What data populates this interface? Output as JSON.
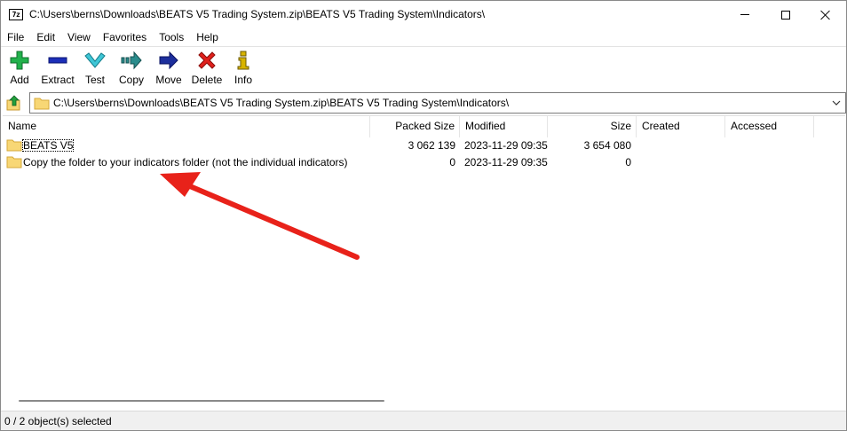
{
  "window": {
    "title": "C:\\Users\\berns\\Downloads\\BEATS V5 Trading System.zip\\BEATS V5 Trading System\\Indicators\\",
    "app_icon_text": "7z"
  },
  "menu": [
    "File",
    "Edit",
    "View",
    "Favorites",
    "Tools",
    "Help"
  ],
  "toolbar": {
    "add": "Add",
    "extract": "Extract",
    "test": "Test",
    "copy": "Copy",
    "move": "Move",
    "delete": "Delete",
    "info": "Info"
  },
  "address": {
    "path": "C:\\Users\\berns\\Downloads\\BEATS V5 Trading System.zip\\BEATS V5 Trading System\\Indicators\\"
  },
  "columns": {
    "name": "Name",
    "packed_size": "Packed Size",
    "modified": "Modified",
    "size": "Size",
    "created": "Created",
    "accessed": "Accessed"
  },
  "rows": [
    {
      "name": "BEATS V5",
      "packed_size": "3 062 139",
      "modified": "2023-11-29 09:35",
      "size": "3 654 080",
      "created": "",
      "accessed": ""
    },
    {
      "name": "Copy the folder to your indicators folder (not the individual indicators)",
      "packed_size": "0",
      "modified": "2023-11-29 09:35",
      "size": "0",
      "created": "",
      "accessed": ""
    }
  ],
  "status": {
    "selection": "0 / 2 object(s) selected"
  },
  "colors": {
    "folder": "#f8d775",
    "folder_dark": "#e4b443",
    "annotation_arrow": "#e8221a",
    "add_icon": "#22b14c",
    "extract_icon": "#1c2eb8",
    "test_icon": "#3fc6d6",
    "copy_icon": "#2a8c8c",
    "move_icon": "#1c2e9c",
    "delete_icon": "#e0201c",
    "info_icon": "#d8b400"
  }
}
